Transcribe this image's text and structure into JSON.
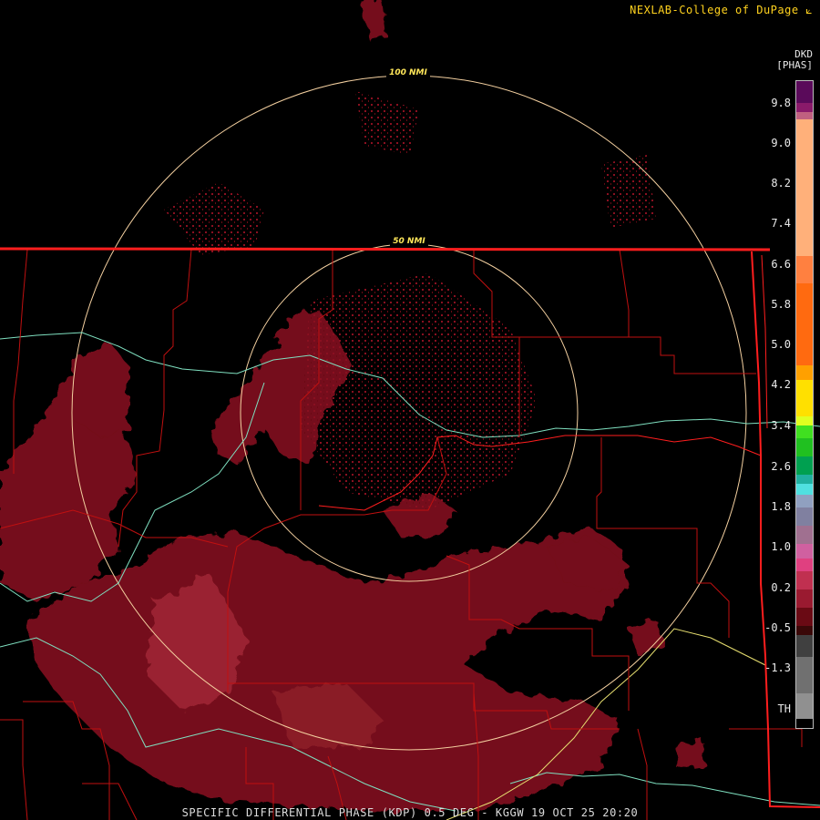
{
  "header": {
    "credit": "NEXLAB-College of DuPage"
  },
  "legend": {
    "product": "DKD",
    "units": "[PHAS]",
    "labels": [
      "9.8",
      "9.0",
      "8.2",
      "7.4",
      "6.6",
      "5.8",
      "5.0",
      "4.2",
      "3.4",
      "2.6",
      "1.8",
      "1.0",
      "0.2",
      "-0.5",
      "-1.3",
      "TH"
    ]
  },
  "range_rings": {
    "inner": "50 NMI",
    "outer": "100 NMI"
  },
  "footer": {
    "caption": "SPECIFIC DIFFERENTIAL PHASE (KDP) 0.5 DEG - KGGW 19 OCT 25 20:20"
  },
  "colors": {
    "background": "#000000",
    "echo": "#7a0f1a",
    "echo_light": "#9a2a3a",
    "state_border": "#ff1e1e",
    "county_border": "#c01010",
    "river": "#7fe0c0",
    "highway": "#e8e070",
    "ring": "#f4d0a0"
  },
  "icons": {
    "credit_mark": "nexlab-logo-icon"
  }
}
